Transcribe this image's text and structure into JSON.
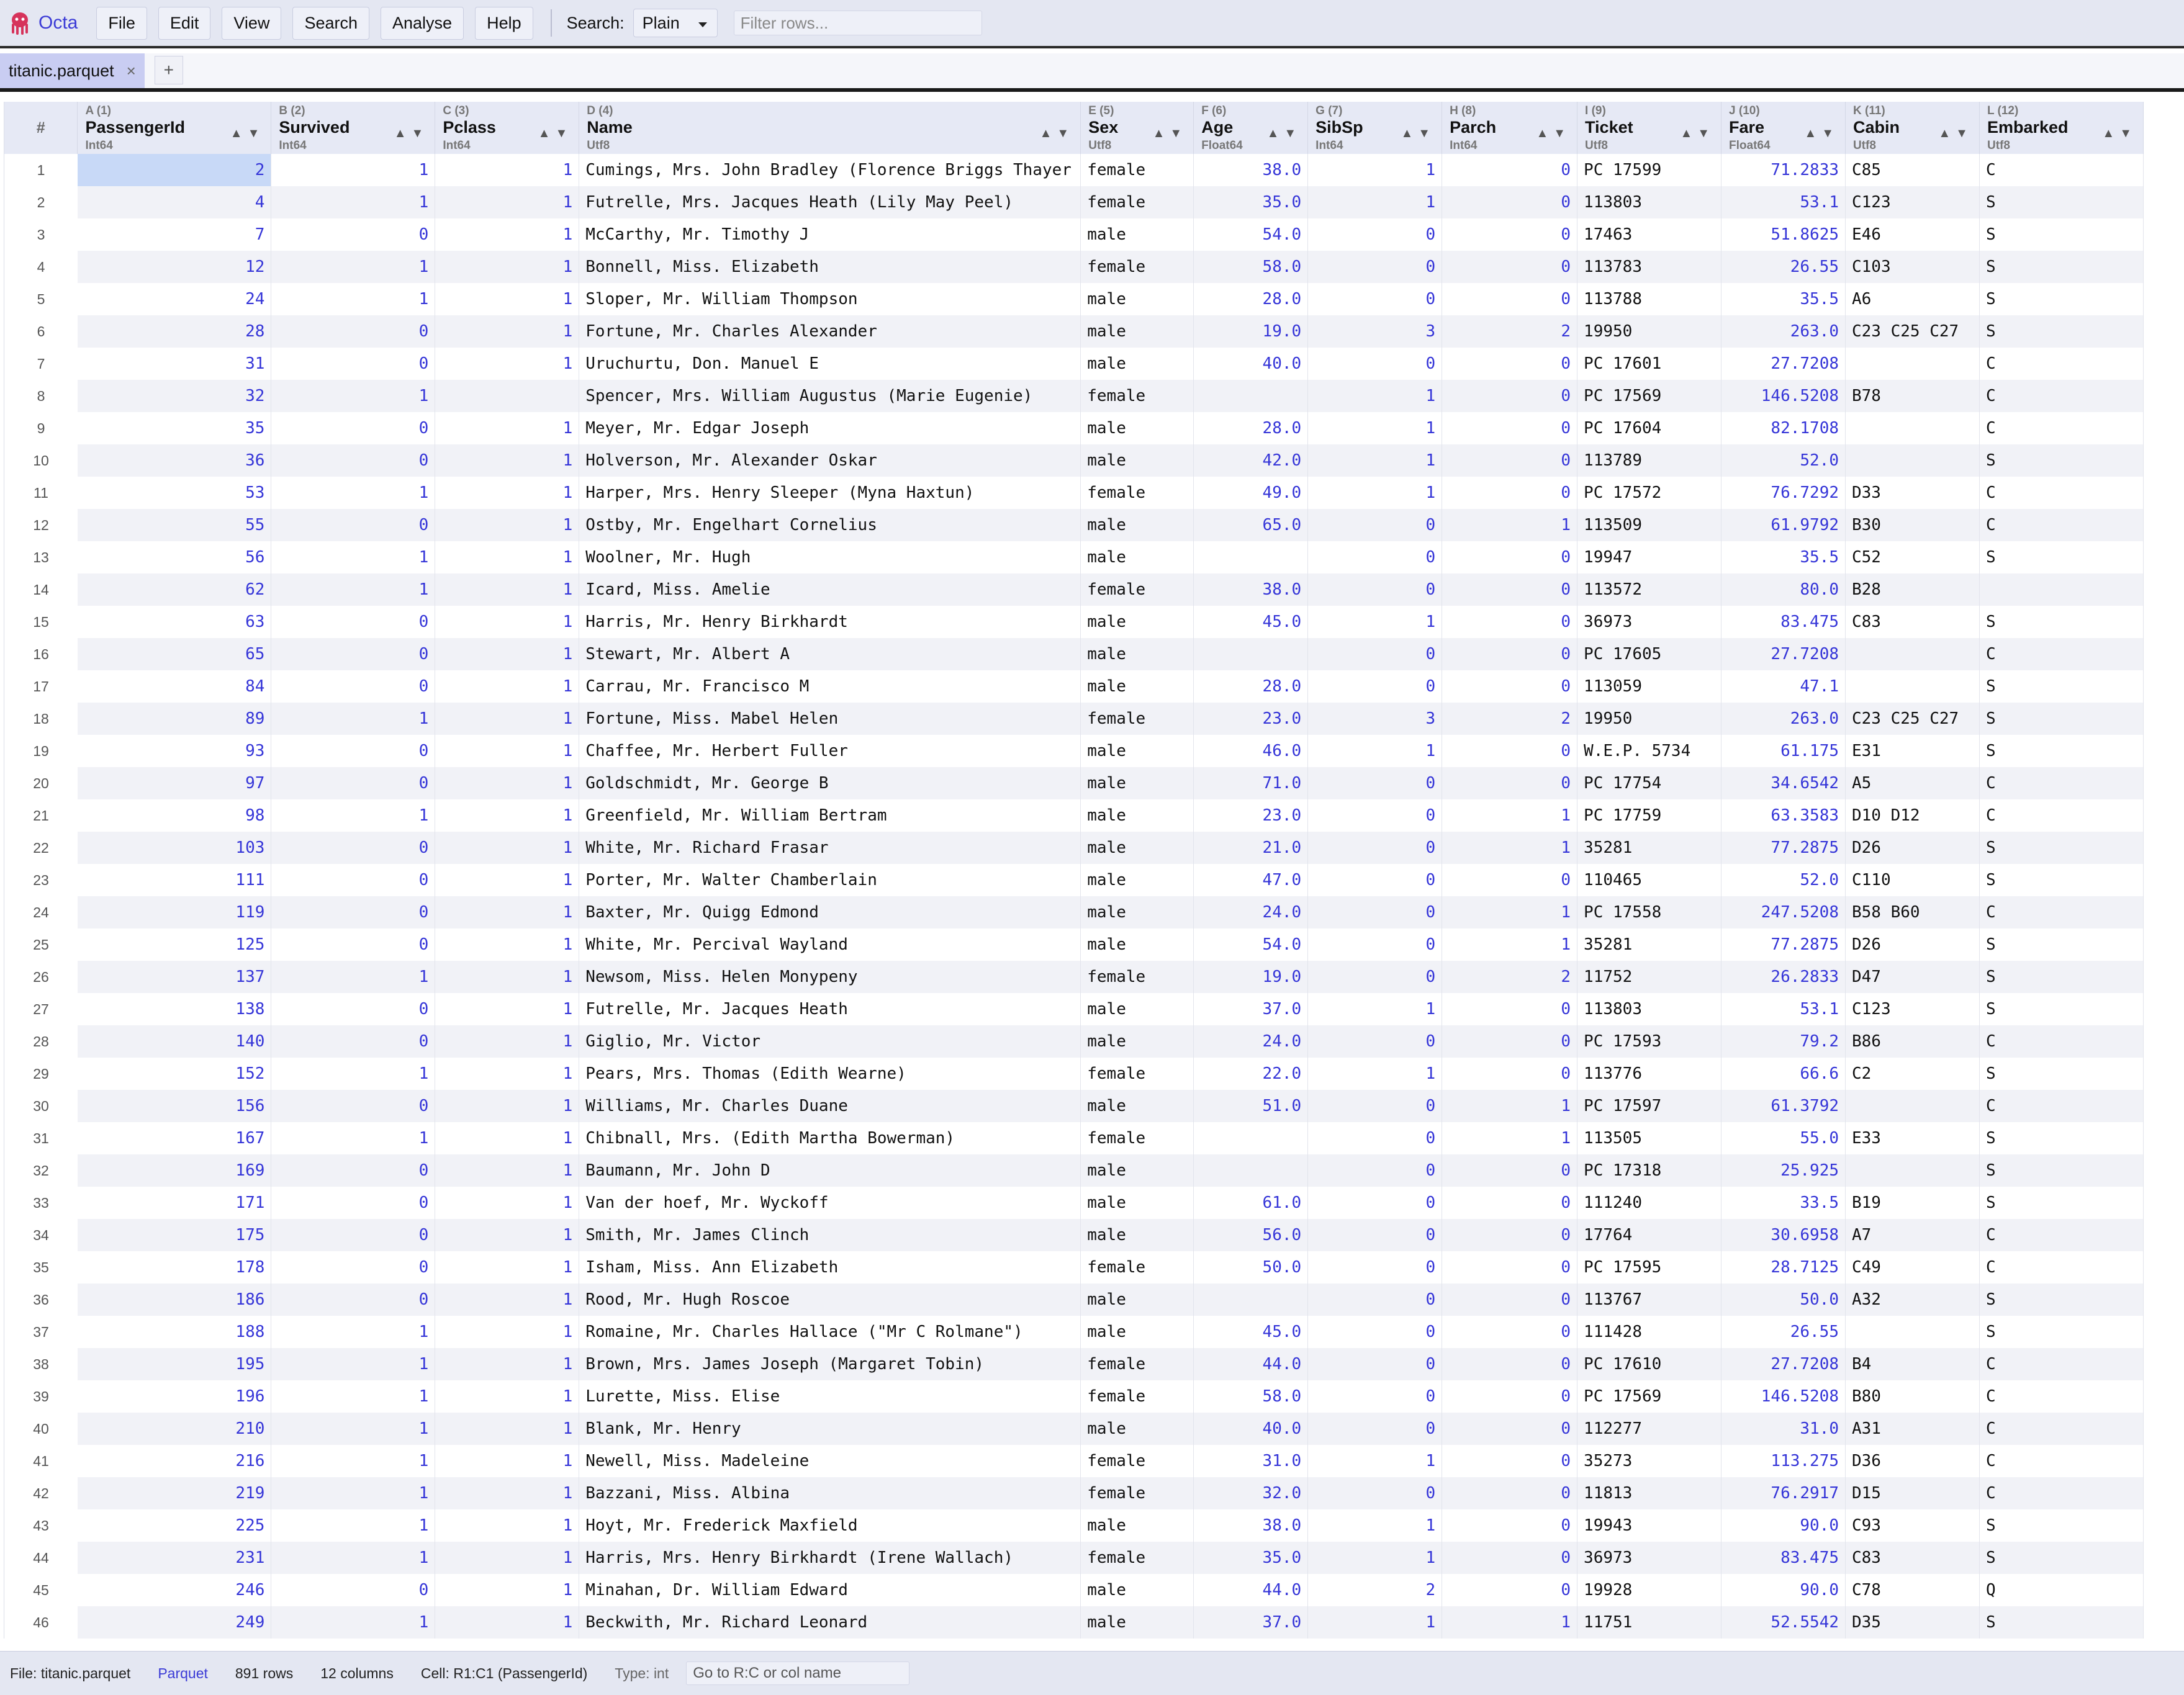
{
  "app": {
    "name": "Octa"
  },
  "menu": {
    "file": "File",
    "edit": "Edit",
    "view": "View",
    "search": "Search",
    "analyse": "Analyse",
    "help": "Help"
  },
  "search": {
    "label": "Search:",
    "mode": "Plain",
    "placeholder": "Filter rows..."
  },
  "tabs": {
    "active_label": "titanic.parquet",
    "close_glyph": "×",
    "add_glyph": "+"
  },
  "grid": {
    "rownum_header": "#",
    "columns": [
      {
        "letter": "A (1)",
        "name": "PassengerId",
        "type": "Int64"
      },
      {
        "letter": "B (2)",
        "name": "Survived",
        "type": "Int64"
      },
      {
        "letter": "C (3)",
        "name": "Pclass",
        "type": "Int64"
      },
      {
        "letter": "D (4)",
        "name": "Name",
        "type": "Utf8"
      },
      {
        "letter": "E (5)",
        "name": "Sex",
        "type": "Utf8"
      },
      {
        "letter": "F (6)",
        "name": "Age",
        "type": "Float64"
      },
      {
        "letter": "G (7)",
        "name": "SibSp",
        "type": "Int64"
      },
      {
        "letter": "H (8)",
        "name": "Parch",
        "type": "Int64"
      },
      {
        "letter": "I (9)",
        "name": "Ticket",
        "type": "Utf8"
      },
      {
        "letter": "J (10)",
        "name": "Fare",
        "type": "Float64"
      },
      {
        "letter": "K (11)",
        "name": "Cabin",
        "type": "Utf8"
      },
      {
        "letter": "L (12)",
        "name": "Embarked",
        "type": "Utf8"
      }
    ],
    "rows": [
      [
        "2",
        "1",
        "1",
        "Cumings, Mrs. John Bradley (Florence Briggs Thayer",
        "female",
        "38.0",
        "1",
        "0",
        "PC 17599",
        "71.2833",
        "C85",
        "C"
      ],
      [
        "4",
        "1",
        "1",
        "Futrelle, Mrs. Jacques Heath (Lily May Peel)",
        "female",
        "35.0",
        "1",
        "0",
        "113803",
        "53.1",
        "C123",
        "S"
      ],
      [
        "7",
        "0",
        "1",
        "McCarthy, Mr. Timothy J",
        "male",
        "54.0",
        "0",
        "0",
        "17463",
        "51.8625",
        "E46",
        "S"
      ],
      [
        "12",
        "1",
        "1",
        "Bonnell, Miss. Elizabeth",
        "female",
        "58.0",
        "0",
        "0",
        "113783",
        "26.55",
        "C103",
        "S"
      ],
      [
        "24",
        "1",
        "1",
        "Sloper, Mr. William Thompson",
        "male",
        "28.0",
        "0",
        "0",
        "113788",
        "35.5",
        "A6",
        "S"
      ],
      [
        "28",
        "0",
        "1",
        "Fortune, Mr. Charles Alexander",
        "male",
        "19.0",
        "3",
        "2",
        "19950",
        "263.0",
        "C23 C25 C27",
        "S"
      ],
      [
        "31",
        "0",
        "1",
        "Uruchurtu, Don. Manuel E",
        "male",
        "40.0",
        "0",
        "0",
        "PC 17601",
        "27.7208",
        "",
        "C"
      ],
      [
        "32",
        "1",
        "",
        "Spencer, Mrs. William Augustus (Marie Eugenie)",
        "female",
        "",
        "1",
        "0",
        "PC 17569",
        "146.5208",
        "B78",
        "C"
      ],
      [
        "35",
        "0",
        "1",
        "Meyer, Mr. Edgar Joseph",
        "male",
        "28.0",
        "1",
        "0",
        "PC 17604",
        "82.1708",
        "",
        "C"
      ],
      [
        "36",
        "0",
        "1",
        "Holverson, Mr. Alexander Oskar",
        "male",
        "42.0",
        "1",
        "0",
        "113789",
        "52.0",
        "",
        "S"
      ],
      [
        "53",
        "1",
        "1",
        "Harper, Mrs. Henry Sleeper (Myna Haxtun)",
        "female",
        "49.0",
        "1",
        "0",
        "PC 17572",
        "76.7292",
        "D33",
        "C"
      ],
      [
        "55",
        "0",
        "1",
        "Ostby, Mr. Engelhart Cornelius",
        "male",
        "65.0",
        "0",
        "1",
        "113509",
        "61.9792",
        "B30",
        "C"
      ],
      [
        "56",
        "1",
        "1",
        "Woolner, Mr. Hugh",
        "male",
        "",
        "0",
        "0",
        "19947",
        "35.5",
        "C52",
        "S"
      ],
      [
        "62",
        "1",
        "1",
        "Icard, Miss. Amelie",
        "female",
        "38.0",
        "0",
        "0",
        "113572",
        "80.0",
        "B28",
        ""
      ],
      [
        "63",
        "0",
        "1",
        "Harris, Mr. Henry Birkhardt",
        "male",
        "45.0",
        "1",
        "0",
        "36973",
        "83.475",
        "C83",
        "S"
      ],
      [
        "65",
        "0",
        "1",
        "Stewart, Mr. Albert A",
        "male",
        "",
        "0",
        "0",
        "PC 17605",
        "27.7208",
        "",
        "C"
      ],
      [
        "84",
        "0",
        "1",
        "Carrau, Mr. Francisco M",
        "male",
        "28.0",
        "0",
        "0",
        "113059",
        "47.1",
        "",
        "S"
      ],
      [
        "89",
        "1",
        "1",
        "Fortune, Miss. Mabel Helen",
        "female",
        "23.0",
        "3",
        "2",
        "19950",
        "263.0",
        "C23 C25 C27",
        "S"
      ],
      [
        "93",
        "0",
        "1",
        "Chaffee, Mr. Herbert Fuller",
        "male",
        "46.0",
        "1",
        "0",
        "W.E.P. 5734",
        "61.175",
        "E31",
        "S"
      ],
      [
        "97",
        "0",
        "1",
        "Goldschmidt, Mr. George B",
        "male",
        "71.0",
        "0",
        "0",
        "PC 17754",
        "34.6542",
        "A5",
        "C"
      ],
      [
        "98",
        "1",
        "1",
        "Greenfield, Mr. William Bertram",
        "male",
        "23.0",
        "0",
        "1",
        "PC 17759",
        "63.3583",
        "D10 D12",
        "C"
      ],
      [
        "103",
        "0",
        "1",
        "White, Mr. Richard Frasar",
        "male",
        "21.0",
        "0",
        "1",
        "35281",
        "77.2875",
        "D26",
        "S"
      ],
      [
        "111",
        "0",
        "1",
        "Porter, Mr. Walter Chamberlain",
        "male",
        "47.0",
        "0",
        "0",
        "110465",
        "52.0",
        "C110",
        "S"
      ],
      [
        "119",
        "0",
        "1",
        "Baxter, Mr. Quigg Edmond",
        "male",
        "24.0",
        "0",
        "1",
        "PC 17558",
        "247.5208",
        "B58 B60",
        "C"
      ],
      [
        "125",
        "0",
        "1",
        "White, Mr. Percival Wayland",
        "male",
        "54.0",
        "0",
        "1",
        "35281",
        "77.2875",
        "D26",
        "S"
      ],
      [
        "137",
        "1",
        "1",
        "Newsom, Miss. Helen Monypeny",
        "female",
        "19.0",
        "0",
        "2",
        "11752",
        "26.2833",
        "D47",
        "S"
      ],
      [
        "138",
        "0",
        "1",
        "Futrelle, Mr. Jacques Heath",
        "male",
        "37.0",
        "1",
        "0",
        "113803",
        "53.1",
        "C123",
        "S"
      ],
      [
        "140",
        "0",
        "1",
        "Giglio, Mr. Victor",
        "male",
        "24.0",
        "0",
        "0",
        "PC 17593",
        "79.2",
        "B86",
        "C"
      ],
      [
        "152",
        "1",
        "1",
        "Pears, Mrs. Thomas (Edith Wearne)",
        "female",
        "22.0",
        "1",
        "0",
        "113776",
        "66.6",
        "C2",
        "S"
      ],
      [
        "156",
        "0",
        "1",
        "Williams, Mr. Charles Duane",
        "male",
        "51.0",
        "0",
        "1",
        "PC 17597",
        "61.3792",
        "",
        "C"
      ],
      [
        "167",
        "1",
        "1",
        "Chibnall, Mrs. (Edith Martha Bowerman)",
        "female",
        "",
        "0",
        "1",
        "113505",
        "55.0",
        "E33",
        "S"
      ],
      [
        "169",
        "0",
        "1",
        "Baumann, Mr. John D",
        "male",
        "",
        "0",
        "0",
        "PC 17318",
        "25.925",
        "",
        "S"
      ],
      [
        "171",
        "0",
        "1",
        "Van der hoef, Mr. Wyckoff",
        "male",
        "61.0",
        "0",
        "0",
        "111240",
        "33.5",
        "B19",
        "S"
      ],
      [
        "175",
        "0",
        "1",
        "Smith, Mr. James Clinch",
        "male",
        "56.0",
        "0",
        "0",
        "17764",
        "30.6958",
        "A7",
        "C"
      ],
      [
        "178",
        "0",
        "1",
        "Isham, Miss. Ann Elizabeth",
        "female",
        "50.0",
        "0",
        "0",
        "PC 17595",
        "28.7125",
        "C49",
        "C"
      ],
      [
        "186",
        "0",
        "1",
        "Rood, Mr. Hugh Roscoe",
        "male",
        "",
        "0",
        "0",
        "113767",
        "50.0",
        "A32",
        "S"
      ],
      [
        "188",
        "1",
        "1",
        "Romaine, Mr. Charles Hallace (\"Mr C Rolmane\")",
        "male",
        "45.0",
        "0",
        "0",
        "111428",
        "26.55",
        "",
        "S"
      ],
      [
        "195",
        "1",
        "1",
        "Brown, Mrs. James Joseph (Margaret Tobin)",
        "female",
        "44.0",
        "0",
        "0",
        "PC 17610",
        "27.7208",
        "B4",
        "C"
      ],
      [
        "196",
        "1",
        "1",
        "Lurette, Miss. Elise",
        "female",
        "58.0",
        "0",
        "0",
        "PC 17569",
        "146.5208",
        "B80",
        "C"
      ],
      [
        "210",
        "1",
        "1",
        "Blank, Mr. Henry",
        "male",
        "40.0",
        "0",
        "0",
        "112277",
        "31.0",
        "A31",
        "C"
      ],
      [
        "216",
        "1",
        "1",
        "Newell, Miss. Madeleine",
        "female",
        "31.0",
        "1",
        "0",
        "35273",
        "113.275",
        "D36",
        "C"
      ],
      [
        "219",
        "1",
        "1",
        "Bazzani, Miss. Albina",
        "female",
        "32.0",
        "0",
        "0",
        "11813",
        "76.2917",
        "D15",
        "C"
      ],
      [
        "225",
        "1",
        "1",
        "Hoyt, Mr. Frederick Maxfield",
        "male",
        "38.0",
        "1",
        "0",
        "19943",
        "90.0",
        "C93",
        "S"
      ],
      [
        "231",
        "1",
        "1",
        "Harris, Mrs. Henry Birkhardt (Irene Wallach)",
        "female",
        "35.0",
        "1",
        "0",
        "36973",
        "83.475",
        "C83",
        "S"
      ],
      [
        "246",
        "0",
        "1",
        "Minahan, Dr. William Edward",
        "male",
        "44.0",
        "2",
        "0",
        "19928",
        "90.0",
        "C78",
        "Q"
      ],
      [
        "249",
        "1",
        "1",
        "Beckwith, Mr. Richard Leonard",
        "male",
        "37.0",
        "1",
        "1",
        "11751",
        "52.5542",
        "D35",
        "S"
      ]
    ]
  },
  "status": {
    "file": "File: titanic.parquet",
    "format": "Parquet",
    "rows": "891 rows",
    "columns": "12 columns",
    "cell": "Cell: R1:C1 (PassengerId)",
    "type": "Type: int",
    "goto_placeholder": "Go to R:C or col name"
  },
  "colors": {
    "accent": "#3b3bd6",
    "header_bg": "#e6e9f5",
    "selected_cell": "#c8d9f7",
    "tab_active": "#c9cdf2"
  },
  "icons": {
    "logo": "octopus-logo-icon",
    "dropdown": "chevron-down-icon",
    "sort": "sort-arrows-icon"
  }
}
